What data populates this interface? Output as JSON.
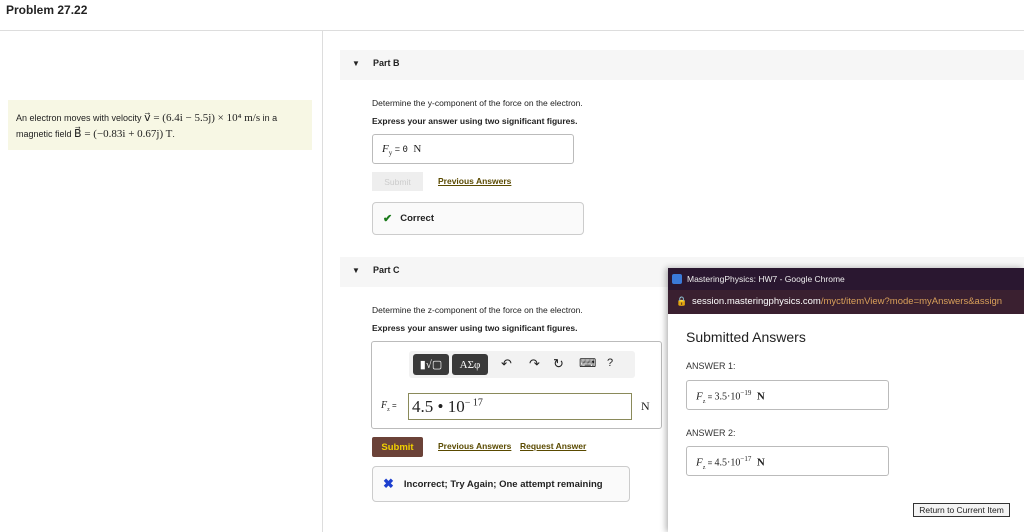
{
  "header": {
    "title": "Problem 27.22"
  },
  "problem": {
    "text1": "An electron moves with velocity ",
    "v_eq": "v⃗ = (6.4i − 5.5j) × 10⁴ m/s",
    "text2": " in a",
    "text3": "magnetic field ",
    "b_eq": "B⃗ = (−0.83i + 0.67j)  T",
    "text4": "."
  },
  "part_b": {
    "label": "Part B",
    "question": "Determine the y-component of the force on the electron.",
    "instruction": "Express your answer using two significant figures.",
    "answer_var": "F",
    "answer_sub": "y",
    "answer_eq": " = ",
    "answer_value": "0",
    "answer_unit": "N",
    "submit": "Submit",
    "previous_answers": "Previous Answers",
    "feedback": "Correct",
    "feedback_icon": "check-icon"
  },
  "part_c": {
    "label": "Part C",
    "question": "Determine the z-component of the force on the electron.",
    "instruction": "Express your answer using two significant figures.",
    "toolbar": {
      "templates": "▮√▢",
      "greek": "ΑΣφ",
      "undo": "↶",
      "redo": "↷",
      "reset": "↻",
      "keyboard": "⌨",
      "help": "?"
    },
    "answer_var": "F",
    "answer_sub": "z",
    "answer_eq": " = ",
    "input_value": "4.5 • 10",
    "input_exp": "− 17",
    "unit": "N",
    "submit": "Submit",
    "previous_answers": "Previous Answers",
    "request_answer": "Request Answer",
    "feedback": "Incorrect; Try Again; One attempt remaining"
  },
  "popup": {
    "window_title": "MasteringPhysics: HW7 - Google Chrome",
    "url_domain": "session.masteringphysics.com",
    "url_path": "/myct/itemView?mode=myAnswers&assign",
    "heading": "Submitted Answers",
    "answers": [
      {
        "label": "ANSWER 1:",
        "var": "F",
        "sub": "z",
        "eq": " = ",
        "mantissa": "3.5·10",
        "exp": "−19",
        "unit": "N"
      },
      {
        "label": "ANSWER 2:",
        "var": "F",
        "sub": "z",
        "eq": " = ",
        "mantissa": "4.5·10",
        "exp": "−17",
        "unit": "N"
      }
    ],
    "return_button": "Return to Current Item"
  },
  "colors": {
    "submit_bg": "#6b4238",
    "submit_text": "#f0d000",
    "check": "#1a7a1a",
    "cross": "#1d3fcf",
    "popup_title_bg": "#2a1730"
  }
}
